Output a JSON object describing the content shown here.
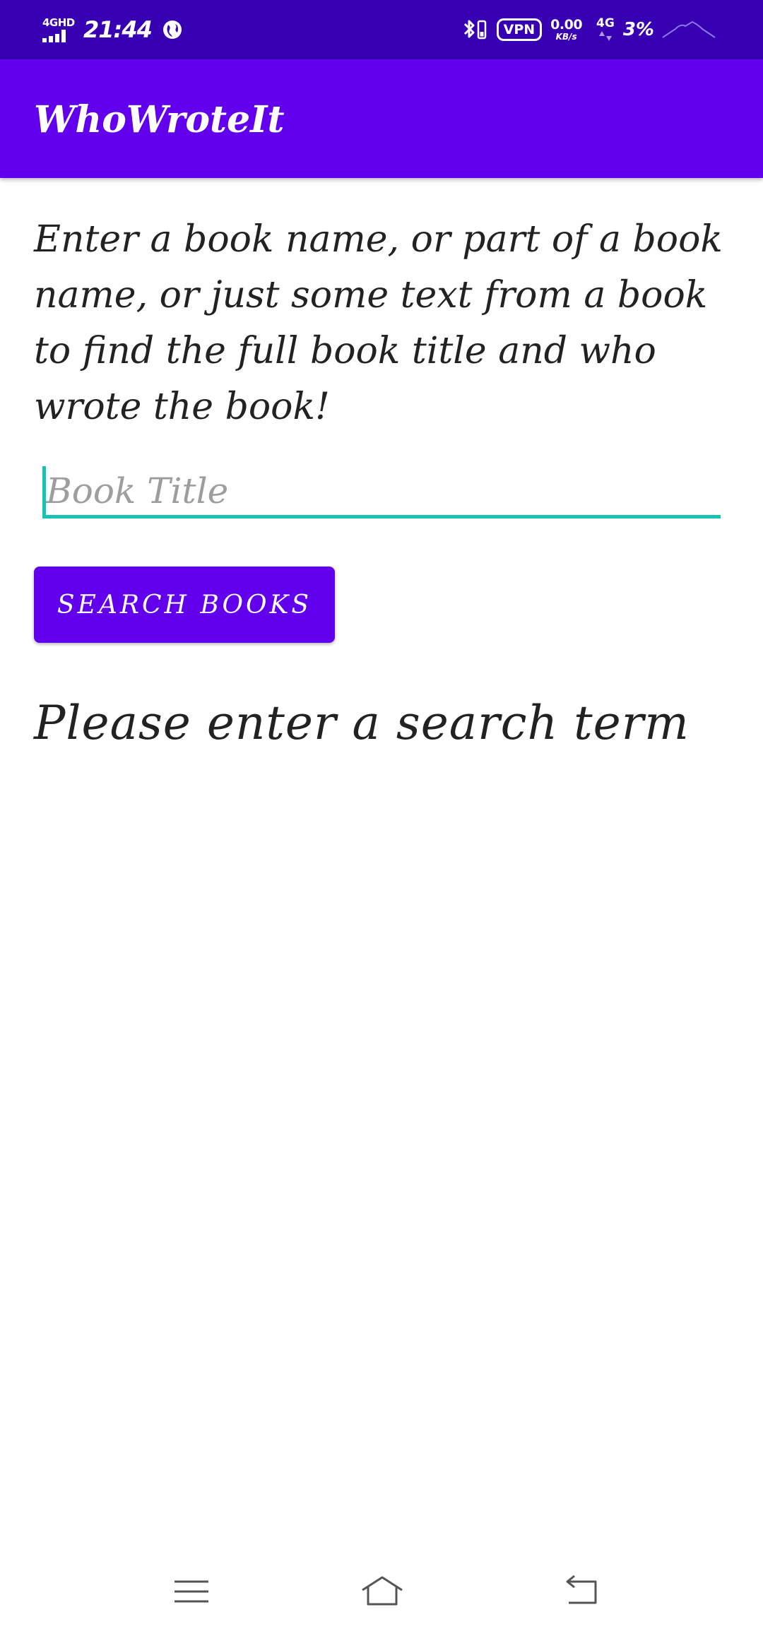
{
  "status_bar": {
    "network_label": "4GHD",
    "time": "21:44",
    "vpn_label": "VPN",
    "speed_value": "0.00",
    "speed_unit": "KB/s",
    "network2_label": "4G",
    "battery": "3%"
  },
  "app_bar": {
    "title": "WhoWroteIt"
  },
  "content": {
    "instructions": "Enter a book name, or part of a book name, or just some text from a book to find the full book title and who wrote the book!",
    "book_title_input": {
      "placeholder": "Book Title",
      "value": ""
    },
    "search_button_label": "SEARCH BOOKS",
    "result_text": "Please enter a search term"
  },
  "colors": {
    "status_bar": "#3700b3",
    "primary": "#6200ee",
    "accent": "#17c3b2",
    "text": "#222222",
    "hint": "#9e9e9e"
  },
  "nav_bar": {
    "icons": [
      "menu-icon",
      "home-icon",
      "back-icon"
    ]
  }
}
